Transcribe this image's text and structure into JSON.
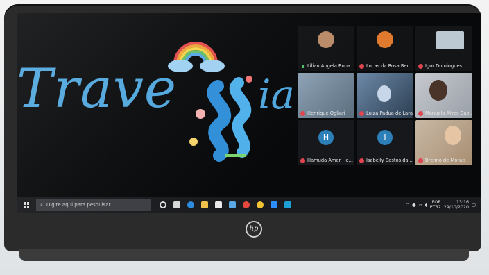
{
  "screen": {
    "logo": {
      "left_text": "Trave",
      "right_text": "ia"
    }
  },
  "zoom": {
    "participants": [
      {
        "name": "Lilian Angela Bona...",
        "mic": "on",
        "type": "avatar"
      },
      {
        "name": "Lucas da Rosa Ber...",
        "mic": "off",
        "type": "avatar"
      },
      {
        "name": "Igor Domingues",
        "mic": "off",
        "type": "avatar"
      },
      {
        "name": "Henrique Ogliari",
        "mic": "off",
        "type": "video"
      },
      {
        "name": "Luiza Padua de Lara",
        "mic": "off",
        "type": "video"
      },
      {
        "name": "Manuela Alves Cab...",
        "mic": "off",
        "type": "video"
      },
      {
        "name": "Hamuda Amer He...",
        "mic": "off",
        "type": "initial",
        "initial": "H"
      },
      {
        "name": "Isabelly Bastos da ...",
        "mic": "off",
        "type": "initial",
        "initial": "I"
      },
      {
        "name": "Brenno de Morais",
        "mic": "off",
        "type": "video"
      }
    ]
  },
  "taskbar": {
    "search_placeholder": "Digite aqui para pesquisar",
    "tray": {
      "language": "POR",
      "keyboard": "PTB2",
      "time": "13:16",
      "date": "29/10/2020"
    }
  },
  "laptop": {
    "brand": "hp"
  },
  "colors": {
    "logo_blue": "#4fa6dd",
    "mic_red": "#e0444e",
    "initial_blue": "#2d7fb8"
  }
}
